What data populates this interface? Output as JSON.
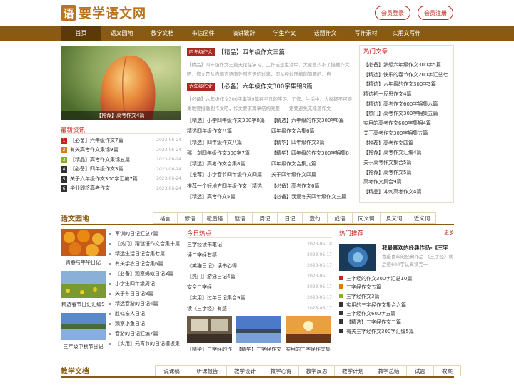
{
  "header": {
    "logo_badge": "语",
    "logo_text": "要学语文网",
    "login": "会员登录",
    "register": "会员注册"
  },
  "nav": [
    "首页",
    "语文园地",
    "教学文档",
    "书信函件",
    "演讲致辞",
    "学生作文",
    "话题作文",
    "写作素材",
    "实用文写作"
  ],
  "carousel": {
    "caption": "【推荐】高考作文4篇"
  },
  "featured": [
    {
      "tag": "四年级作文",
      "title": "【精品】四年级作文三篇",
      "summary": "【精品】四年级作文三篇无论在学习、工作或是生活中，大家总少不了接触作文吧，作文是从内部言语向外部言语的过渡，即从经过压缩的简要的、自"
    },
    {
      "tag": "六年级作文",
      "title": "【必备】六年级作文300字集锦9篇",
      "summary": "【必备】六年级作文300字集锦9篇在平凡的学习、工作、生活中，大家都不可避免地要接触到作文吧，作文要求篇章结构完整，一定要避免无缘落作文"
    }
  ],
  "mid_list": [
    "【精选】小学四年级作文300字8篇",
    "【精选】六年级的作文300字8篇",
    "精选四年级作文八篇",
    "四年级作文合集6篇",
    "【精选】四年级作文八篇",
    "【精华】四年级作文3篇",
    "那一刻四年级作文300字7篇",
    "【精华】四年级的作文300字锦集8",
    "【精选】高考作文合集8篇",
    "四年级作文合集九篇",
    "【推荐】小学春节四年级作文四篇",
    "关于四年级作文四篇",
    "推荐一个好地方四年级作文（精选",
    "【必备】高考作文6篇",
    "【精选】高考作文5篇",
    "【必备】我爱冬天四年级作文三篇"
  ],
  "latest": {
    "title": "最新资讯",
    "items": [
      {
        "num": "1",
        "text": "【必备】六年级作文7篇",
        "date": "2023-06-24"
      },
      {
        "num": "2",
        "text": "有关高考作文集锦9篇",
        "date": "2023-06-24"
      },
      {
        "num": "3",
        "text": "【精品】高考作文集锦五篇",
        "date": "2023-06-24"
      },
      {
        "num": "4",
        "text": "【必备】四年级作文3篇",
        "date": "2023-06-24"
      },
      {
        "num": "5",
        "text": "关于六年级作文300字汇编7篇",
        "date": "2023-06-24"
      },
      {
        "num": "6",
        "text": "毕业即将高考作文",
        "date": "2023-06-24"
      }
    ]
  },
  "hot_articles": {
    "title": "热门文章",
    "items": [
      "【必备】梦想六年级作文300字5篇",
      "【精选】快乐的春节作文200字汇总七",
      "【精选】六年级的作文300字3篇",
      "精选初一反思作文4篇",
      "【精选】高考作文600字锦集六篇",
      "【热门】高考作文300字锦集五篇",
      "实用的高考作文600字集锦4篇",
      "关于高考作文300字锦集五篇",
      "【推荐】高考作文四篇",
      "【推荐】高考作文汇编4篇",
      "关于高考作文集合5篇",
      "【推荐】高考作文5篇",
      "高考作文集合9篇",
      "【精品】冲刺高考作文4篇"
    ]
  },
  "garden": {
    "title": "语文园地",
    "tabs": [
      "格言",
      "谚语",
      "歇后语",
      "谜语",
      "周记",
      "日记",
      "造句",
      "成语",
      "同义词",
      "反义词",
      "近义词"
    ],
    "thumbs": [
      {
        "cap": "青春与年华日记"
      },
      {
        "cap": "精选春节日记汇编9"
      },
      {
        "cap": "三年级中秋节日记"
      }
    ],
    "list": [
      "军训的日记汇总7篇",
      "【热门】猜谜语作文合集十篇",
      "精选生活日记合集七篇",
      "有关学农日记合集6篇",
      "【必备】观察蚂蚁日记3篇",
      "小学生四年级周记",
      "关于冬日日记8篇",
      "精选春游的日记4篇",
      "胜似亲人日记",
      "观察小鱼日记",
      "春游的日记汇编7篇",
      "【实用】元宵节的日记模板集"
    ],
    "today_hot": {
      "title": "今日热点",
      "items": [
        {
          "text": "三字经读书笔记",
          "date": "2023-06-18"
        },
        {
          "text": "读三字经有感",
          "date": "2023-06-17"
        },
        {
          "text": "《笑猫日记》读书心得",
          "date": "2023-06-17"
        },
        {
          "text": "【热门】游泳日记4篇",
          "date": "2023-06-17"
        },
        {
          "text": "安全三字经",
          "date": "2023-06-17"
        },
        {
          "text": "【实用】过年日记集合9篇",
          "date": "2023-06-17"
        },
        {
          "text": "读《三字经》有感",
          "date": "2023-06-17"
        }
      ],
      "pics": [
        "【精华】三字经的作",
        "【精华】三字经作文",
        "实用的三字经作文集"
      ]
    },
    "recommend": {
      "title": "热门推荐",
      "more": "更多",
      "feature_title": "我最喜欢的经典作品-《三字",
      "feature_sum": "我最喜欢的经典作品-《三字经》读后感600字认真读完一",
      "items": [
        "三字经的作文300字汇总10篇",
        "三字经作文五篇",
        "三字经作文3篇",
        "实用的三字经作文集合六篇",
        "三字经作文600字五篇",
        "【精选】三字经作文三篇",
        "有关三字经作文300字汇编5篇"
      ]
    }
  },
  "docs": {
    "title": "教学文档",
    "tabs": [
      "说课稿",
      "听课报告",
      "教学设计",
      "教学心得",
      "教学反思",
      "教学计划",
      "教学总结",
      "试题",
      "教案"
    ]
  },
  "colors": {
    "brand": "#8a5a12",
    "accent": "#c0261c"
  }
}
